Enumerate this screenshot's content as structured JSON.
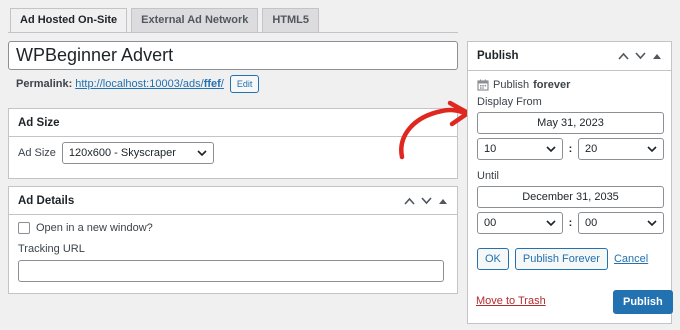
{
  "tabs": [
    {
      "label": "Ad Hosted On-Site",
      "active": true
    },
    {
      "label": "External Ad Network",
      "active": false
    },
    {
      "label": "HTML5",
      "active": false
    }
  ],
  "title": {
    "value": "WPBeginner Advert"
  },
  "permalink": {
    "label": "Permalink:",
    "url_base": "http://localhost:10003/ads/",
    "url_slug": "ffef",
    "url_tail": "/",
    "edit_label": "Edit"
  },
  "ad_size": {
    "heading": "Ad Size",
    "field_label": "Ad Size",
    "selected": "120x600 - Skyscraper"
  },
  "ad_details": {
    "heading": "Ad Details",
    "checkbox_label": "Open in a new window?",
    "tracking_label": "Tracking URL",
    "tracking_value": ""
  },
  "publish": {
    "heading": "Publish",
    "status_prefix": "Publish",
    "status_value": "forever",
    "display_from_label": "Display From",
    "from_date": "May 31, 2023",
    "from_hour": "10",
    "from_minute": "20",
    "until_label": "Until",
    "until_date": "December 31, 2035",
    "until_hour": "00",
    "until_minute": "00",
    "ok_label": "OK",
    "forever_label": "Publish Forever",
    "cancel_label": "Cancel",
    "trash_label": "Move to Trash",
    "publish_label": "Publish"
  },
  "colors": {
    "accent": "#2271b1",
    "danger": "#b32d2e",
    "annotation_arrow": "#e0271f"
  }
}
